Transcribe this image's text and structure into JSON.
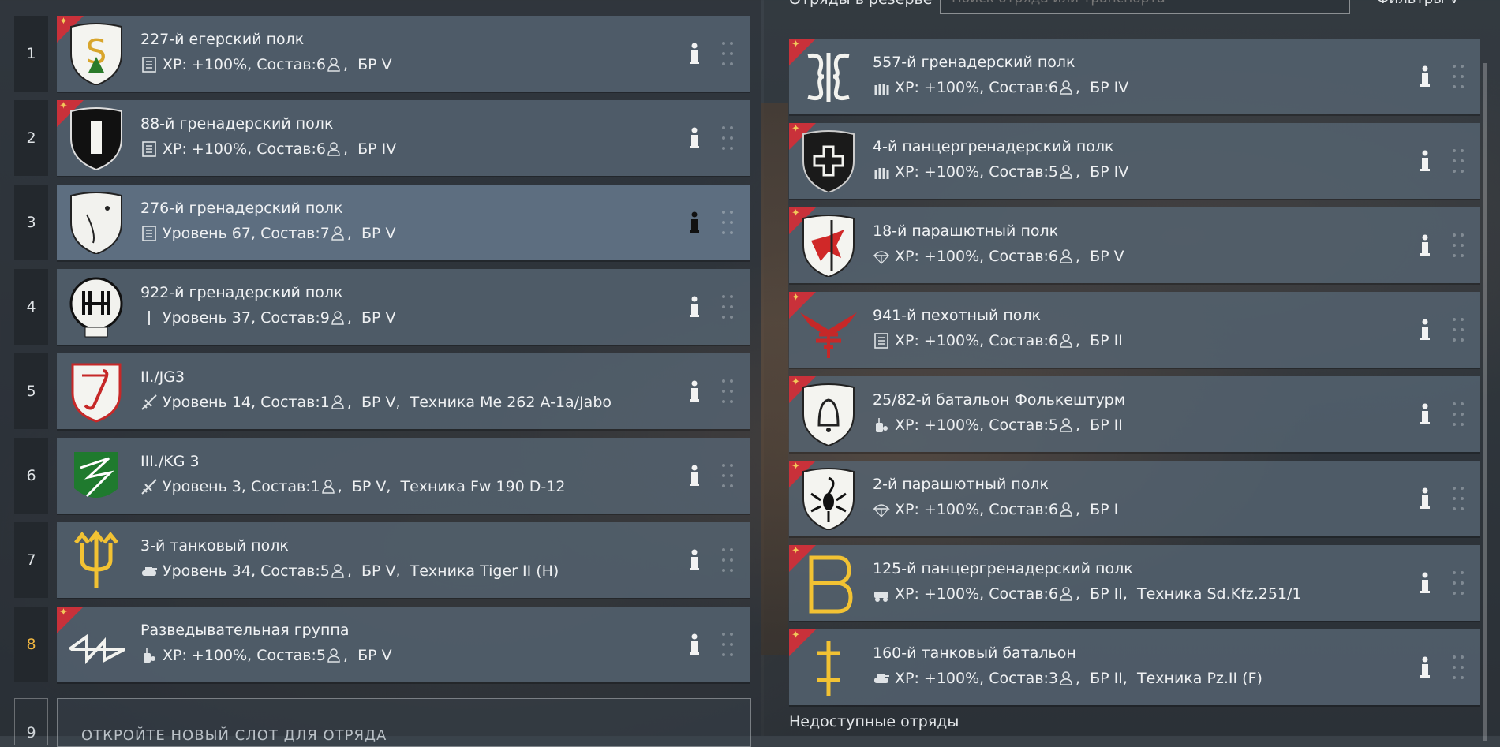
{
  "reserve": {
    "header": "Отряды в резерве",
    "search_placeholder": "Поиск отряда или транспорта",
    "filter_label": "Фильтры",
    "unavailable_label": "Недоступные отряды"
  },
  "new_slot": {
    "number": "9",
    "label": "ОТКРОЙТЕ НОВЫЙ СЛОТ ДЛЯ ОТРЯДА"
  },
  "active": [
    {
      "num": "1",
      "title": "227-й егерский полк",
      "type": "list",
      "level": "XP: +100%",
      "size": "6",
      "br": "БР V",
      "vehicle": "",
      "elite": true,
      "emblem": "jaeger-shield"
    },
    {
      "num": "2",
      "title": "88-й гренадерский полк",
      "type": "list",
      "level": "XP: +100%",
      "size": "6",
      "br": "БР IV",
      "vehicle": "",
      "elite": true,
      "emblem": "black-bar-shield"
    },
    {
      "num": "3",
      "title": "276-й гренадерский полк",
      "type": "list",
      "level": "Уровень 67",
      "size": "7",
      "br": "БР V",
      "vehicle": "",
      "elite": false,
      "emblem": "sabre-shield"
    },
    {
      "num": "4",
      "title": "922-й гренадерский полк",
      "type": "knife",
      "level": "Уровень 37",
      "size": "9",
      "br": "БР V",
      "vehicle": "",
      "elite": false,
      "emblem": "922-circle"
    },
    {
      "num": "5",
      "title": "II./JG3",
      "type": "plane",
      "level": "Уровень 14",
      "size": "1",
      "br": "БР V",
      "vehicle": "Техника Me 262 A-1a/Jabo",
      "elite": false,
      "emblem": "jg3-shield"
    },
    {
      "num": "6",
      "title": "III./KG 3",
      "type": "plane",
      "level": "Уровень 3",
      "size": "1",
      "br": "БР V",
      "vehicle": "Техника Fw 190 D-12",
      "elite": false,
      "emblem": "kg3-lightning"
    },
    {
      "num": "7",
      "title": "3-й танковый полк",
      "type": "tank",
      "level": "Уровень 34",
      "size": "5",
      "br": "БР V",
      "vehicle": "Техника Tiger II (H)",
      "elite": false,
      "emblem": "trident"
    },
    {
      "num": "8",
      "title": "Разведывательная группа",
      "type": "radio",
      "level": "XP: +100%",
      "size": "5",
      "br": "БР V",
      "vehicle": "",
      "elite": true,
      "emblem": "recon-rune"
    }
  ],
  "reserve_list": [
    {
      "title": "557-й гренадерский полк",
      "type": "ammo",
      "level": "XP: +100%",
      "size": "6",
      "br": "БР IV",
      "vehicle": "",
      "elite": true,
      "emblem": "557-rune"
    },
    {
      "title": "4-й панцергренадерский полк",
      "type": "ammo",
      "level": "XP: +100%",
      "size": "5",
      "br": "БР IV",
      "vehicle": "",
      "elite": true,
      "emblem": "cross-shield"
    },
    {
      "title": "18-й парашютный полк",
      "type": "para",
      "level": "XP: +100%",
      "size": "6",
      "br": "БР V",
      "vehicle": "",
      "elite": true,
      "emblem": "eagle-shield"
    },
    {
      "title": "941-й пехотный полк",
      "type": "list",
      "level": "XP: +100%",
      "size": "6",
      "br": "БР II",
      "vehicle": "",
      "elite": true,
      "emblem": "red-wings"
    },
    {
      "title": "25/82-й батальон Фолькештурм",
      "type": "radio",
      "level": "XP: +100%",
      "size": "5",
      "br": "БР II",
      "vehicle": "",
      "elite": true,
      "emblem": "bell-shield"
    },
    {
      "title": "2-й парашютный полк",
      "type": "para",
      "level": "XP: +100%",
      "size": "6",
      "br": "БР I",
      "vehicle": "",
      "elite": true,
      "emblem": "scorpion-shield"
    },
    {
      "title": "125-й панцергренадерский полк",
      "type": "halftrack",
      "level": "XP: +100%",
      "size": "6",
      "br": "БР II",
      "vehicle": "Техника Sd.Kfz.251/1",
      "elite": true,
      "emblem": "yellow-b"
    },
    {
      "title": "160-й танковый батальон",
      "type": "tank",
      "level": "XP: +100%",
      "size": "3",
      "br": "БР II",
      "vehicle": "Техника Pz.II (F)",
      "elite": true,
      "emblem": "yellow-cross-rune"
    }
  ]
}
